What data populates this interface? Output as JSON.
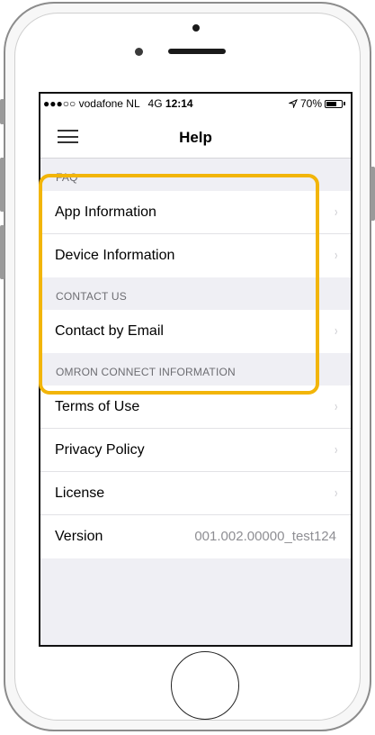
{
  "status_bar": {
    "signal": "●●●○○",
    "carrier": "vodafone NL",
    "network": "4G",
    "time": "12:14",
    "location_icon": "location-arrow-icon",
    "battery_percent": "70%",
    "battery_level": 0.7
  },
  "nav": {
    "title": "Help",
    "menu_icon": "hamburger-menu-icon"
  },
  "sections": [
    {
      "header": "FAQ",
      "rows": [
        {
          "label": "App Information",
          "chevron": "›"
        },
        {
          "label": "Device Information",
          "chevron": "›"
        }
      ]
    },
    {
      "header": "CONTACT US",
      "rows": [
        {
          "label": "Contact by Email",
          "chevron": "›"
        }
      ]
    },
    {
      "header": "OMRON CONNECT INFORMATION",
      "rows": [
        {
          "label": "Terms of Use",
          "chevron": "›"
        },
        {
          "label": "Privacy Policy",
          "chevron": "›"
        },
        {
          "label": "License",
          "chevron": "›"
        },
        {
          "label": "Version",
          "value": "001.002.00000_test124"
        }
      ]
    }
  ],
  "colors": {
    "highlight": "#f2b509",
    "background": "#efeff4",
    "chevron": "#c7c7cc"
  }
}
